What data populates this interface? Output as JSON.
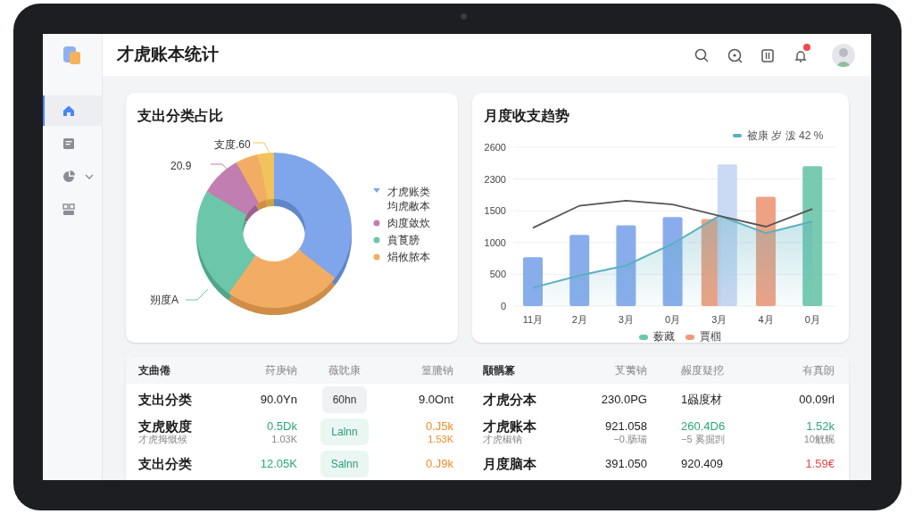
{
  "app": {
    "title": "才虎账本统计"
  },
  "sidebar": {
    "items": [
      {
        "selected": true,
        "expandable": false
      },
      {
        "selected": false,
        "expandable": false
      },
      {
        "selected": false,
        "expandable": true
      },
      {
        "selected": false,
        "expandable": false
      }
    ]
  },
  "header_actions": [
    {
      "badge": false
    },
    {
      "badge": false
    },
    {
      "badge": false
    },
    {
      "badge": true
    }
  ],
  "pie_card": {
    "title": "支出分类占比",
    "labels": [
      {
        "text": "支度.60",
        "color": "#f2c35c"
      },
      {
        "text": "20.9",
        "color": "#c07fb0"
      },
      {
        "text": "朔度A",
        "color": "#6cc7aa"
      }
    ],
    "legend": [
      {
        "label": "才虎账类",
        "sublabel": "均虎敝本",
        "color": "#7fa6ea"
      },
      {
        "label": "肉度敛炊",
        "color": "#c07fb0"
      },
      {
        "label": "賁莨膀",
        "color": "#6cc7aa"
      },
      {
        "label": "焆攸脓本",
        "color": "#f2ad64"
      }
    ]
  },
  "trend_card": {
    "title": "月度收支趋势",
    "y_labels": [
      "2600",
      "2300",
      "1500",
      "1000",
      "500",
      "0"
    ],
    "x_labels": [
      "11月",
      "2月",
      "3月",
      "0月",
      "3月",
      "4月",
      "0月"
    ],
    "legend_top": {
      "label": "被康 岁 泼 42 %",
      "color": "#5bb0c0"
    },
    "legend": [
      {
        "label": "薮藏",
        "color": "#6cc7aa"
      },
      {
        "label": "賈椢",
        "color": "#ee9a78"
      }
    ]
  },
  "tables": [
    {
      "columns": [
        "支曲倦",
        "荮庚钠",
        "薇眈康",
        "篁膔钠"
      ],
      "rows": [
        {
          "cells": [
            {
              "text": "支出分类"
            },
            {
              "text": "90.0Yn"
            },
            {
              "text": "60hn",
              "kind": "pill"
            },
            {
              "text": "9.0Ont"
            }
          ]
        },
        {
          "cells": [
            {
              "text": "支虎败度",
              "sub": "才虎拇慨候"
            },
            {
              "text": "0.5Dk",
              "sub": "1.03K",
              "color": "#2aa876"
            },
            {
              "text": "Lalnn",
              "kind": "pill",
              "color": "#2a9d80"
            },
            {
              "text": "0.J5k",
              "sub": "1.53K",
              "color": "#f08c2a",
              "sub_tinted": true
            }
          ]
        },
        {
          "cells": [
            {
              "text": "支出分类"
            },
            {
              "text": "12.05K",
              "color": "#2aa876"
            },
            {
              "text": "Salnn",
              "kind": "pill",
              "color": "#2a9d80"
            },
            {
              "text": "0.J9k",
              "color": "#f08c2a"
            }
          ]
        }
      ]
    },
    {
      "columns": [
        "颙髃篡",
        "芆荑钠",
        "赧度疑挖",
        "有真朗"
      ],
      "rows": [
        {
          "cells": [
            {
              "text": "才虎分本"
            },
            {
              "text": "230.0PG"
            },
            {
              "text": "1赑度材"
            },
            {
              "text": "00.09rl"
            }
          ]
        },
        {
          "cells": [
            {
              "text": "才虎账本",
              "sub": "才虎椒钠"
            },
            {
              "text": "921.058",
              "sub": "−0.肠瑞"
            },
            {
              "text": "260.4D6",
              "sub": "−5 奚掘剀",
              "color": "#2aa876"
            },
            {
              "text": "1.52k",
              "sub": "10觥艉",
              "color": "#2aa876"
            }
          ]
        },
        {
          "cells": [
            {
              "text": "月度脑本"
            },
            {
              "text": "391.050"
            },
            {
              "text": "920.409"
            },
            {
              "text": "1.59€",
              "color": "#e54848"
            }
          ]
        }
      ]
    }
  ]
}
